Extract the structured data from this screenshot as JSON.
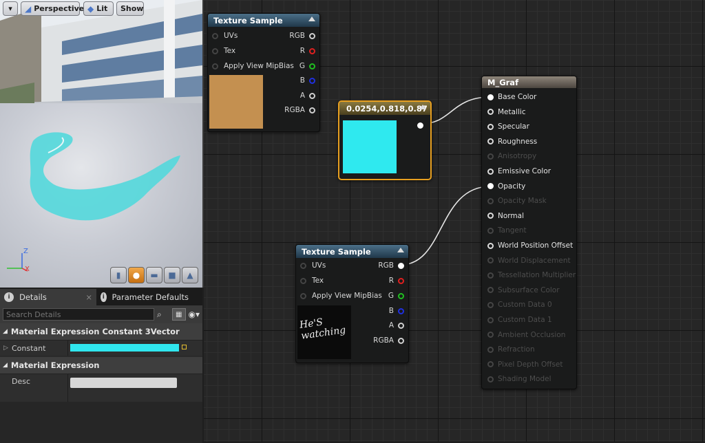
{
  "viewport": {
    "perspective_label": "Perspective",
    "lit_label": "Lit",
    "show_label": "Show",
    "axis": {
      "z": "Z",
      "x": "X"
    }
  },
  "details": {
    "tabs": [
      {
        "label": "Details"
      },
      {
        "label": "Parameter Defaults"
      }
    ],
    "search_placeholder": "Search Details",
    "section1": "Material Expression Constant 3Vector",
    "constant_label": "Constant",
    "constant_color": "#30e6ee",
    "section2": "Material Expression",
    "desc_label": "Desc",
    "desc_value": ""
  },
  "graph": {
    "texture_sample_1": {
      "title": "Texture Sample",
      "inputs": [
        "UVs",
        "Tex",
        "Apply View MipBias"
      ],
      "outputs": [
        "RGB",
        "R",
        "G",
        "B",
        "A",
        "RGBA"
      ],
      "preview_color": "#c49050"
    },
    "constant_node": {
      "title": "0.0254,0.818,0.87",
      "color": "#2fe9ef"
    },
    "texture_sample_2": {
      "title": "Texture Sample",
      "inputs": [
        "UVs",
        "Tex",
        "Apply View MipBias"
      ],
      "outputs": [
        "RGB",
        "R",
        "G",
        "B",
        "A",
        "RGBA"
      ],
      "preview_text": "He'S watching"
    },
    "material_node": {
      "title": "M_Graf",
      "inputs": [
        {
          "label": "Base Color",
          "active": true
        },
        {
          "label": "Metallic",
          "active": true
        },
        {
          "label": "Specular",
          "active": true
        },
        {
          "label": "Roughness",
          "active": true
        },
        {
          "label": "Anisotropy",
          "active": false
        },
        {
          "label": "Emissive Color",
          "active": true
        },
        {
          "label": "Opacity",
          "active": true
        },
        {
          "label": "Opacity Mask",
          "active": false
        },
        {
          "label": "Normal",
          "active": true
        },
        {
          "label": "Tangent",
          "active": false
        },
        {
          "label": "World Position Offset",
          "active": true
        },
        {
          "label": "World Displacement",
          "active": false
        },
        {
          "label": "Tessellation Multiplier",
          "active": false
        },
        {
          "label": "Subsurface Color",
          "active": false
        },
        {
          "label": "Custom Data 0",
          "active": false
        },
        {
          "label": "Custom Data 1",
          "active": false
        },
        {
          "label": "Ambient Occlusion",
          "active": false
        },
        {
          "label": "Refraction",
          "active": false
        },
        {
          "label": "Pixel Depth Offset",
          "active": false
        },
        {
          "label": "Shading Model",
          "active": false
        }
      ]
    }
  },
  "colors": {
    "pin_r": "#e02020",
    "pin_g": "#20c020",
    "pin_b": "#2030e0",
    "selected_border": "#e8a020"
  }
}
